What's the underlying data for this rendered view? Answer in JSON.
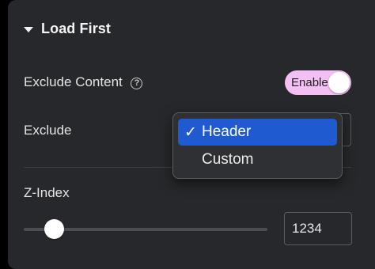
{
  "section": {
    "title": "Load First"
  },
  "exclude_content": {
    "label": "Exclude Content",
    "help_icon": "?",
    "toggle_label": "Enable",
    "toggle_state": "on",
    "toggle_color": "#f4bff2"
  },
  "exclude": {
    "label": "Exclude",
    "selected": "Header",
    "options": [
      {
        "check": "✓",
        "label": "Header"
      },
      {
        "check": "",
        "label": "Custom"
      }
    ],
    "selected_color": "#1f5ad0"
  },
  "z_index": {
    "label": "Z-Index",
    "value": "1234"
  }
}
